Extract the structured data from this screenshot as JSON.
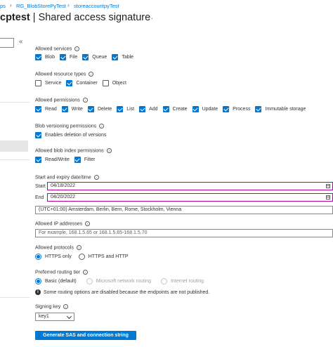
{
  "breadcrumb": {
    "item1": "ps",
    "item2": "RG_BlobStorePyTest",
    "item3": "storeaccountpyTest"
  },
  "header": {
    "account": "cptest",
    "separator": "|",
    "title": "Shared access signature",
    "more": "···"
  },
  "sidebar": {
    "collapse_glyph": "«"
  },
  "services": {
    "label": "Allowed services",
    "items": [
      {
        "label": "Blob",
        "checked": true
      },
      {
        "label": "File",
        "checked": true
      },
      {
        "label": "Queue",
        "checked": true
      },
      {
        "label": "Table",
        "checked": true
      }
    ]
  },
  "resource_types": {
    "label": "Allowed resource types",
    "items": [
      {
        "label": "Service",
        "checked": false
      },
      {
        "label": "Container",
        "checked": true
      },
      {
        "label": "Object",
        "checked": false
      }
    ]
  },
  "permissions": {
    "label": "Allowed permissions",
    "items": [
      {
        "label": "Read",
        "checked": true
      },
      {
        "label": "Write",
        "checked": true
      },
      {
        "label": "Delete",
        "checked": true
      },
      {
        "label": "List",
        "checked": true
      },
      {
        "label": "Add",
        "checked": true
      },
      {
        "label": "Create",
        "checked": true
      },
      {
        "label": "Update",
        "checked": true
      },
      {
        "label": "Process",
        "checked": true
      },
      {
        "label": "Immutable storage",
        "checked": true
      }
    ]
  },
  "versioning": {
    "label": "Blob versioning permissions",
    "option": "Enables deletion of versions",
    "checked": true
  },
  "index_permissions": {
    "label": "Allowed blob index permissions",
    "items": [
      {
        "label": "Read/Write",
        "checked": true
      },
      {
        "label": "Filter",
        "checked": true
      }
    ]
  },
  "dates": {
    "label": "Start and expiry date/time",
    "start_label": "Start",
    "start_value": "04/18/2022",
    "end_label": "End",
    "end_value": "04/20/2022",
    "timezone": "(UTC+01:00) Amsterdam, Berlin, Bern, Rome, Stockholm, Vienna"
  },
  "ip": {
    "label": "Allowed IP addresses",
    "placeholder": "For example, 168.1.5.65 or 168.1.5.65-168.1.5.70"
  },
  "protocols": {
    "label": "Allowed protocols",
    "options": [
      {
        "label": "HTTPS only",
        "selected": true
      },
      {
        "label": "HTTPS and HTTP",
        "selected": false
      }
    ]
  },
  "routing": {
    "label": "Preferred routing tier",
    "options": [
      {
        "label": "Basic (default)",
        "selected": true,
        "disabled": false
      },
      {
        "label": "Microsoft network routing",
        "selected": false,
        "disabled": true
      },
      {
        "label": "Internet routing",
        "selected": false,
        "disabled": true
      }
    ],
    "note": "Some routing options are disabled because the endpoints are not published."
  },
  "signing": {
    "label": "Signing key",
    "value": "key1"
  },
  "generate_button": "Generate SAS and connection string",
  "icons": {
    "info": "i",
    "calendar": "calendar-icon",
    "chevron": "chevron-down-icon"
  },
  "colors": {
    "accent": "#0078d4",
    "date_border": "#b4009e"
  }
}
